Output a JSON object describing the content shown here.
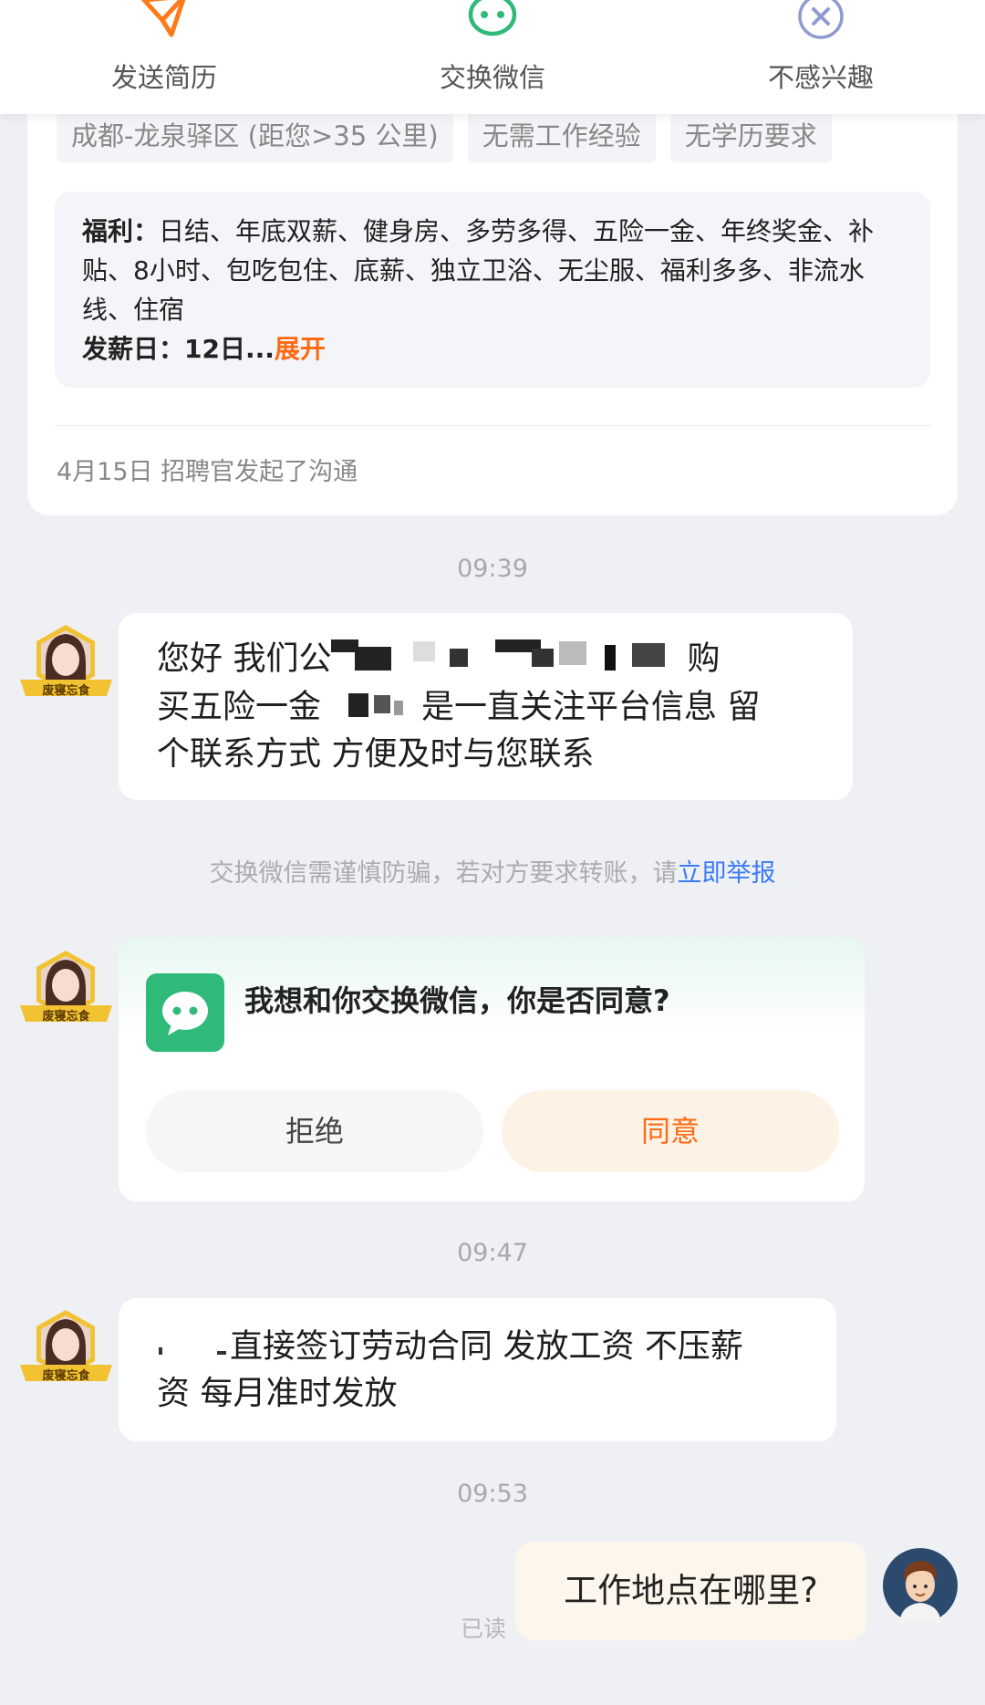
{
  "actions": {
    "send_resume": "发送简历",
    "exchange_wechat": "交换微信",
    "not_interested": "不感兴趣"
  },
  "job": {
    "tags": [
      "成都-龙泉驿区 (距您>35 公里)",
      "无需工作经验",
      "无学历要求"
    ],
    "benefits_label": "福利：",
    "benefits": "日结、年底双薪、健身房、多劳多得、五险一金、年终奖金、补贴、8小时、包吃包住、底薪、独立卫浴、无尘服、福利多多、非流水线、住宿",
    "payday_label": "发薪日：",
    "payday": "12日...",
    "expand": "展开",
    "started": "4月15日 招聘官发起了沟通"
  },
  "chat": {
    "time1": "09:39",
    "recruiter_badge": "废寝忘食",
    "msg1": {
      "line1_a": "您好 我们公",
      "line1_b": "购",
      "line2_a": "买五险一金",
      "line2_b": "是一直关注平台信息 留",
      "line3": "个联系方式 方便及时与您联系"
    },
    "notice_text": "交换微信需谨慎防骗，若对方要求转账，请",
    "notice_link": "立即举报",
    "wechat_request": "我想和你交换微信，你是否同意?",
    "refuse": "拒绝",
    "agree": "同意",
    "time2": "09:47",
    "msg2": {
      "line1": "直接签订劳动合同 发放工资 不压薪",
      "line2": "资 每月准时发放"
    },
    "time3": "09:53",
    "my_msg": "工作地点在哪里?",
    "read": "已读"
  },
  "colors": {
    "accent_orange": "#ff6a12",
    "wechat_green": "#2fba79",
    "link_blue": "#3b7bf5",
    "background": "#eef0f4"
  },
  "icons": [
    "send-icon",
    "wechat-icon",
    "close-circle-icon"
  ]
}
